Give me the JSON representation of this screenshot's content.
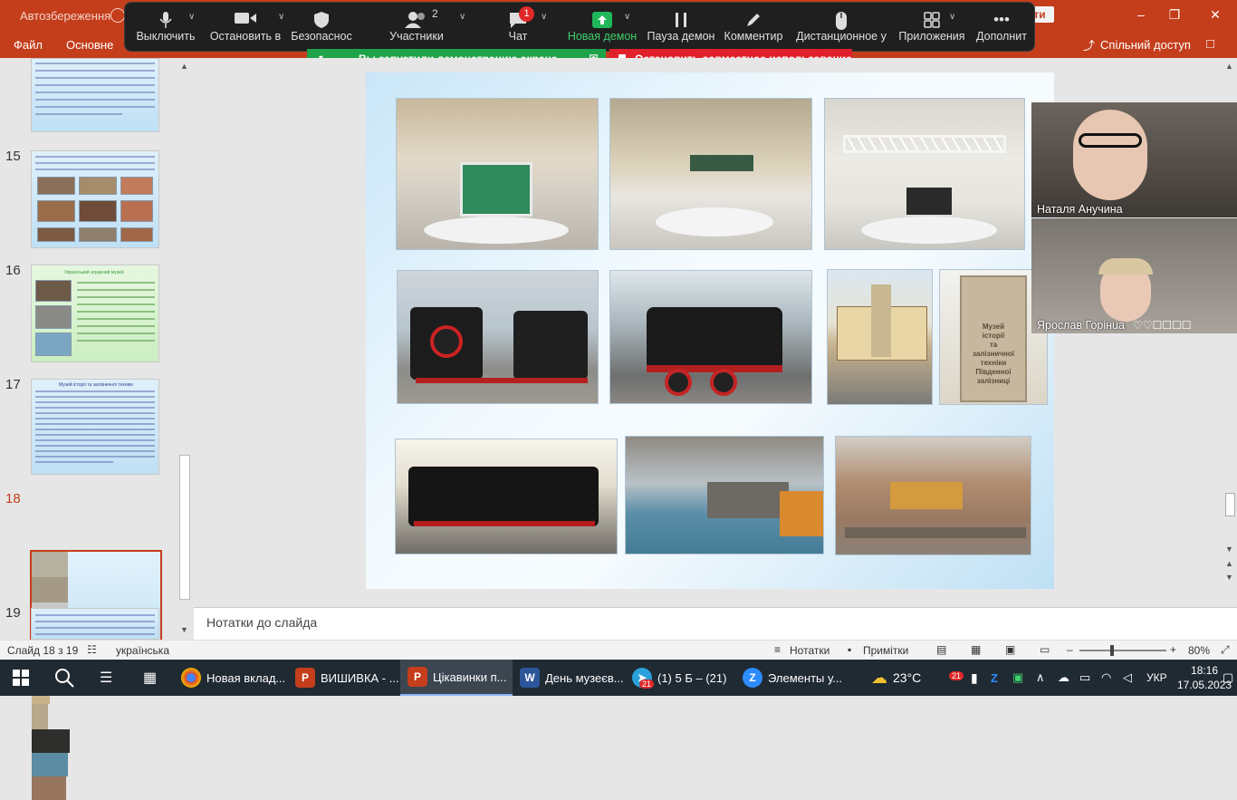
{
  "titlebar": {
    "autosave": "Автозбереження",
    "sign_in": "йти"
  },
  "ribbon": {
    "tabs": [
      "Файл",
      "Основне"
    ],
    "share": "Спільний доступ"
  },
  "zoom": {
    "buttons": [
      {
        "label": "Выключить",
        "icon": "microphone-icon"
      },
      {
        "label": "Остановить в",
        "icon": "video-camera-icon"
      },
      {
        "label": "Безопаснос",
        "icon": "shield-icon"
      },
      {
        "label": "Участники",
        "icon": "participants-icon",
        "count": "2"
      },
      {
        "label": "Чат",
        "icon": "chat-icon",
        "badge": "1"
      },
      {
        "label": "Новая демон",
        "icon": "share-screen-icon"
      },
      {
        "label": "Пауза демон",
        "icon": "pause-icon"
      },
      {
        "label": "Комментир",
        "icon": "pencil-icon"
      },
      {
        "label": "Дистанционное у",
        "icon": "mouse-icon"
      },
      {
        "label": "Приложения",
        "icon": "apps-icon"
      },
      {
        "label": "Дополнит",
        "icon": "more-icon"
      }
    ],
    "share_banner": "Вы запустили демонстрацию экрана",
    "stop_banner": "Остановить совместное использование",
    "participants": [
      {
        "name": "Наталя Анучина"
      },
      {
        "name": "Ярослав Горінuа"
      }
    ]
  },
  "slides": {
    "numbers": [
      "15",
      "16",
      "17",
      "18",
      "19"
    ],
    "slide16_title": "Український аграрний музей",
    "slide17_title": "Музей історії та залізничної техніки"
  },
  "slide": {
    "photo_captions": [
      "Музей",
      "історії",
      "та",
      "залізничної техніки",
      "Південної",
      "залізниці"
    ]
  },
  "notes": {
    "placeholder": "Нотатки до слайда"
  },
  "status": {
    "slide_info": "Слайд 18 з 19",
    "language": "українська",
    "notes_btn": "Нотатки",
    "comments_btn": "Примітки",
    "zoom": "80%"
  },
  "taskbar": {
    "apps": [
      {
        "label": "Новая вклад...",
        "icon": "chrome-icon"
      },
      {
        "label": "ВИШИВКА - ...",
        "icon": "powerpoint-icon"
      },
      {
        "label": "Цікавинки п...",
        "icon": "powerpoint-icon"
      },
      {
        "label": "День музеєв...",
        "icon": "word-icon"
      },
      {
        "label": "(1) 5 Б – (21)",
        "icon": "telegram-icon",
        "badge": "21"
      },
      {
        "label": "Элементы у...",
        "icon": "zoom-icon"
      }
    ],
    "weather": "23°C",
    "lang": "УКР",
    "time": "18:16",
    "date": "17.05.2023",
    "tray_badge": "21"
  }
}
